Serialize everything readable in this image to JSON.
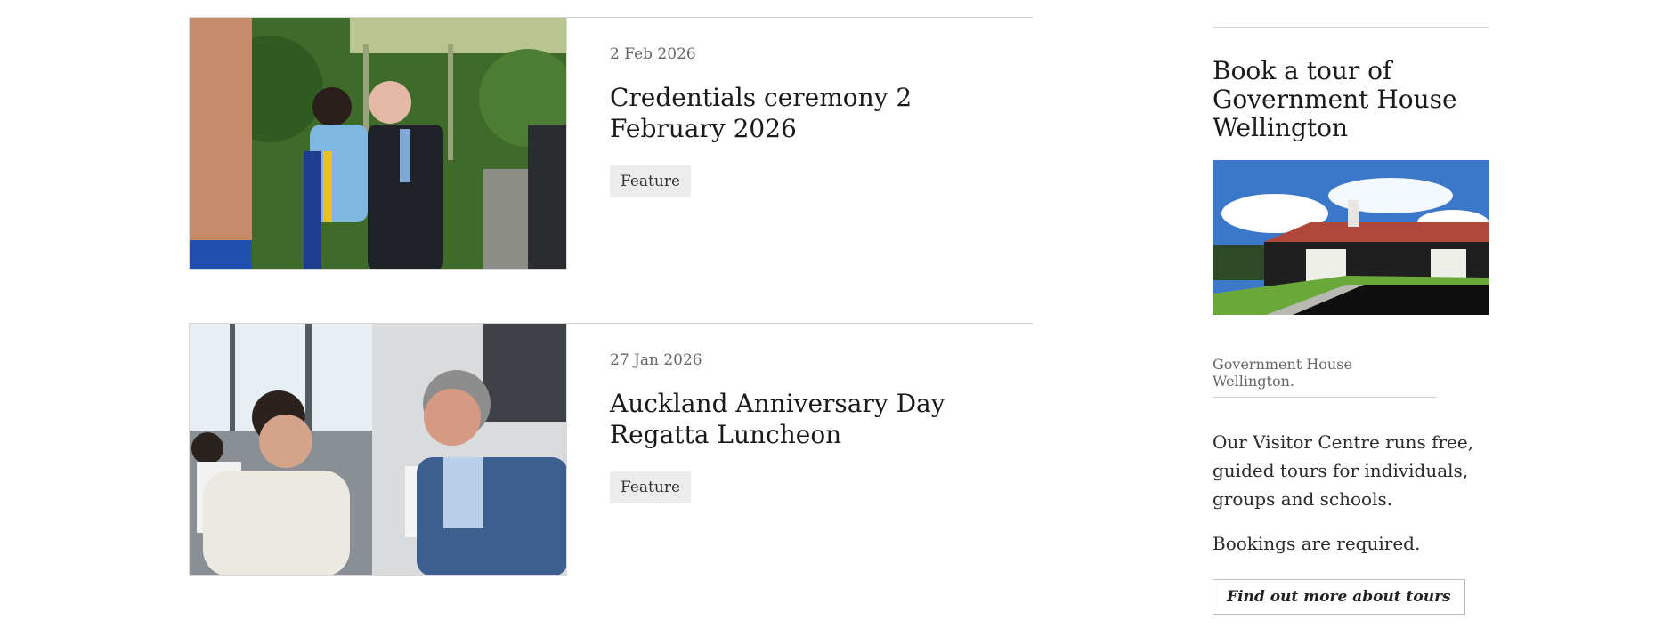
{
  "articles": [
    {
      "date": "2 Feb 2026",
      "title": "Credentials ceremony 2 February 2026",
      "tag": "Feature",
      "image_alt": "Hongi greeting at credentials ceremony"
    },
    {
      "date": "27 Jan 2026",
      "title": "Auckland Anniversary Day Regatta Luncheon",
      "tag": "Feature",
      "image_alt": "Governor-General greeting a guest at luncheon"
    }
  ],
  "sidebar": {
    "heading": "Book a tour of Government House Wellington",
    "image_alt": "Government House Wellington",
    "caption": "Government House Wellington.",
    "body": [
      "Our Visitor Centre runs free, guided tours for individuals, groups and schools.",
      "Bookings are required."
    ],
    "button_label": "Find out more about tours"
  },
  "colors": {
    "rule": "#cfcfcf",
    "tag_bg": "#ececec",
    "muted_text": "#666666"
  }
}
